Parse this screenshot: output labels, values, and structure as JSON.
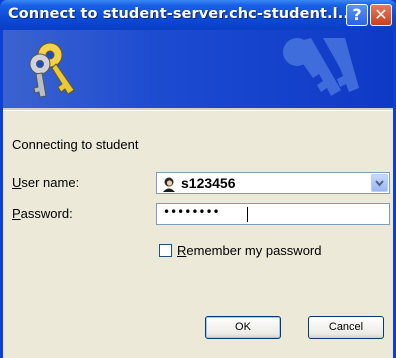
{
  "window": {
    "title": "Connect to student-server.chc-student.l...",
    "help_label": "?",
    "close_label": "✕"
  },
  "icons": {
    "banner": "keys-icon",
    "user": "user-icon",
    "dropdown": "chevron-down-icon"
  },
  "dialog": {
    "connecting_text": "Connecting to student",
    "username_label": "User name:",
    "username_value": "s123456",
    "password_label": "Password:",
    "password_value": "••••••••",
    "remember_label": "Remember my password",
    "remember_checked": false,
    "ok_label": "OK",
    "cancel_label": "Cancel"
  },
  "colors": {
    "titlebar": "#0c4ad6",
    "banner": "#1d4bd0",
    "client": "#ece9d8",
    "close_button": "#c8401d"
  }
}
